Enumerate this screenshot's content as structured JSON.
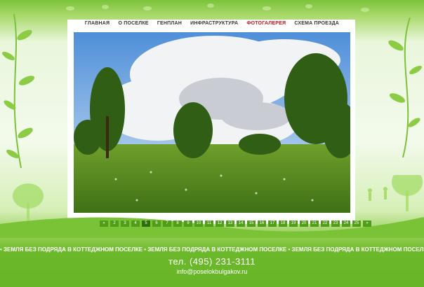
{
  "nav": {
    "items": [
      "ГЛАВНАЯ",
      "О ПОСЕЛКЕ",
      "ГЕНПЛАН",
      "ИНФРАСТРУКТУРА",
      "ФОТОГАЛЕРЕЯ",
      "СХЕМА ПРОЕЗДА"
    ],
    "active_index": 4,
    "active_color": "#c0151d"
  },
  "gallery": {
    "pages": [
      "«",
      "2",
      "3",
      "4",
      "5",
      "6",
      "7",
      "8",
      "9",
      "10",
      "11",
      "12",
      "13",
      "14",
      "15",
      "16",
      "17",
      "18",
      "19",
      "20",
      "21",
      "22",
      "23",
      "24",
      "25",
      "»"
    ],
    "current_page": "5"
  },
  "footer": {
    "slogan": "• ЗЕМЛЯ БЕЗ ПОДРЯДА В КОТТЕДЖНОМ ПОСЕЛКЕ • ЗЕМЛЯ БЕЗ ПОДРЯДА В КОТТЕДЖНОМ ПОСЕЛКЕ • ЗЕМЛЯ БЕЗ ПОДРЯДА В КОТТЕДЖНОМ ПОСЕЛКЕ •",
    "phone": "тел. (495) 231-3111",
    "email": "info@poselokbulgakov.ru"
  },
  "colors": {
    "brand_green": "#6bb92a",
    "pager_green": "#4f9d18"
  }
}
